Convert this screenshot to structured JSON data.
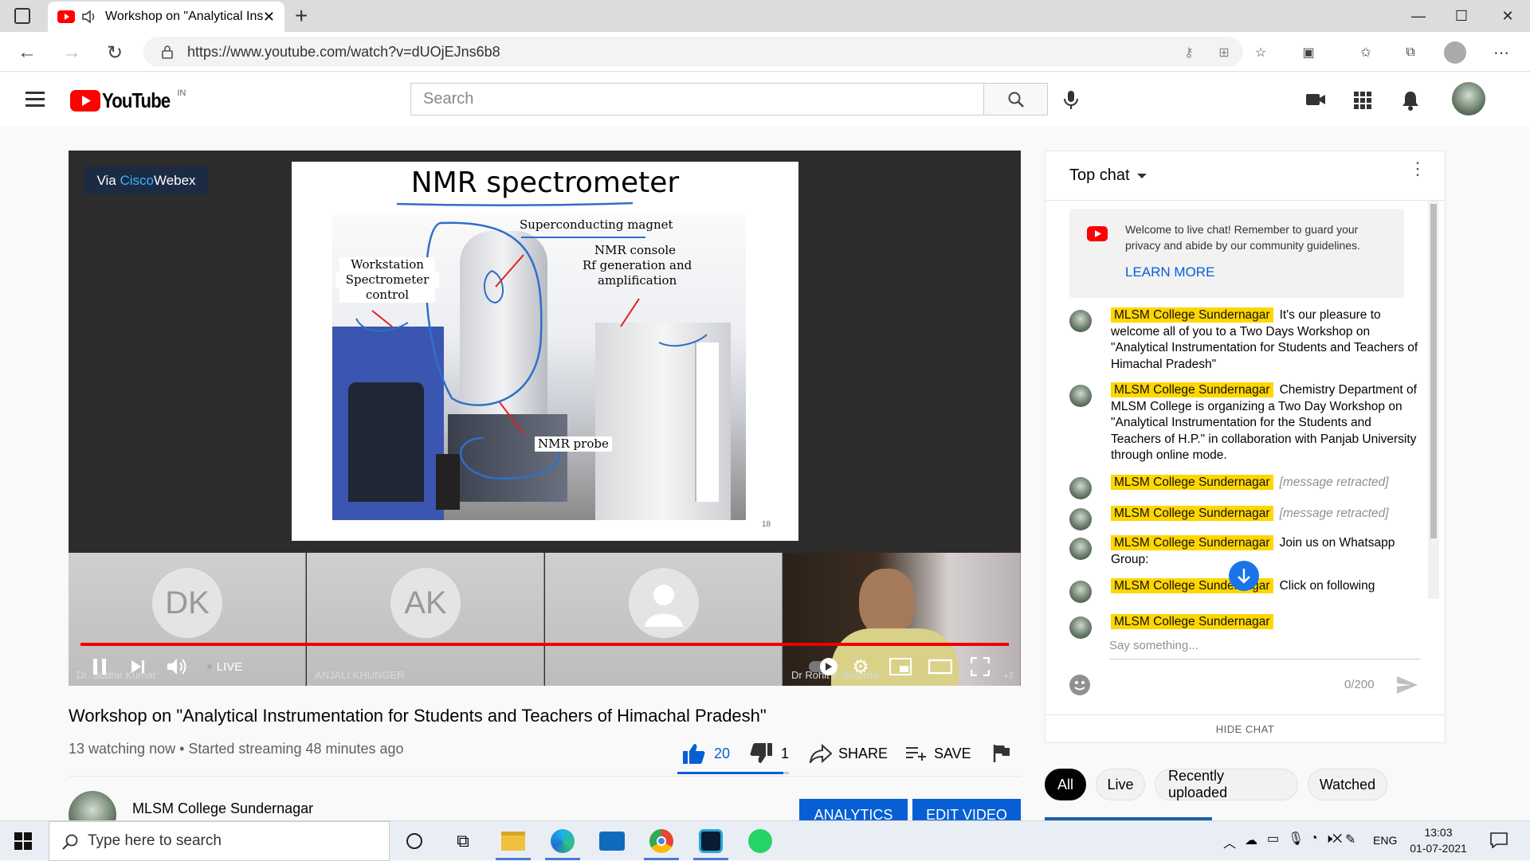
{
  "browser": {
    "tab_title": "Workshop on \"Analytical Ins",
    "url": "https://www.youtube.com/watch?v=dUOjEJns6b8"
  },
  "youtube": {
    "logo_text": "YouTube",
    "region": "IN",
    "search_placeholder": "Search"
  },
  "player": {
    "webex_prefix": "Via",
    "webex_brand": "Cisco",
    "webex_suffix": "Webex",
    "slide_title": "NMR spectrometer",
    "slide_labels": {
      "magnet": "Superconducting magnet",
      "console_1": "NMR console",
      "console_2": "Rf generation and",
      "console_3": "amplification",
      "workstation_1": "Workstation",
      "workstation_2": "Spectrometer",
      "workstation_3": "control",
      "probe": "NMR probe",
      "page_number": "18"
    },
    "participants": [
      {
        "initials": "DK",
        "name": "Dr. Sudhir Kumar"
      },
      {
        "initials": "AK",
        "name": "ANJALI KHUNGER"
      },
      {
        "initials": "",
        "name": ""
      },
      {
        "initials": "",
        "name": "Dr Rohit K Sharma"
      }
    ],
    "extra_participants": "+7",
    "live_label": "LIVE"
  },
  "video": {
    "title": "Workshop on \"Analytical Instrumentation for Students and Teachers of Himachal Pradesh\"",
    "meta": "13 watching now • Started streaming 48 minutes ago",
    "likes": "20",
    "dislikes": "1",
    "share_label": "SHARE",
    "save_label": "SAVE",
    "channel_name": "MLSM College Sundernagar",
    "analytics_label": "ANALYTICS",
    "edit_label": "EDIT VIDEO"
  },
  "chat": {
    "header": "Top chat",
    "welcome_text": "Welcome to live chat! Remember to guard your privacy and abide by our community guidelines.",
    "learn_more": "LEARN MORE",
    "messages": [
      {
        "author": "MLSM College Sundernagar",
        "text": "It's our pleasure to welcome all of you to a Two Days Workshop on \"Analytical Instrumentation for Students and Teachers of Himachal Pradesh\""
      },
      {
        "author": "MLSM College Sundernagar",
        "text": "Chemistry Department of MLSM College is organizing a Two Day Workshop on \"Analytical Instrumentation for the Students and Teachers of H.P.\" in collaboration with Panjab University through online mode."
      },
      {
        "author": "MLSM College Sundernagar",
        "text": "[message retracted]"
      },
      {
        "author": "MLSM College Sundernagar",
        "text": "[message retracted]"
      },
      {
        "author": "MLSM College Sundernagar",
        "text": "Join us on Whatsapp Group:"
      },
      {
        "author": "MLSM College Sundernagar",
        "text": "Click on following"
      },
      {
        "author": "MLSM College Sundernagar",
        "text": ""
      }
    ],
    "input_placeholder": "Say something...",
    "char_count": "0/200",
    "hide_chat": "HIDE CHAT"
  },
  "chips": [
    "All",
    "Live",
    "Recently uploaded",
    "Watched"
  ],
  "taskbar": {
    "search_placeholder": "Type here to search",
    "language": "ENG",
    "time": "13:03",
    "date": "01-07-2021"
  },
  "colors": {
    "youtube_red": "#ff0000",
    "like_blue": "#065fd4",
    "badge_yellow": "#ffd600",
    "progress_red": "#ee0000"
  }
}
